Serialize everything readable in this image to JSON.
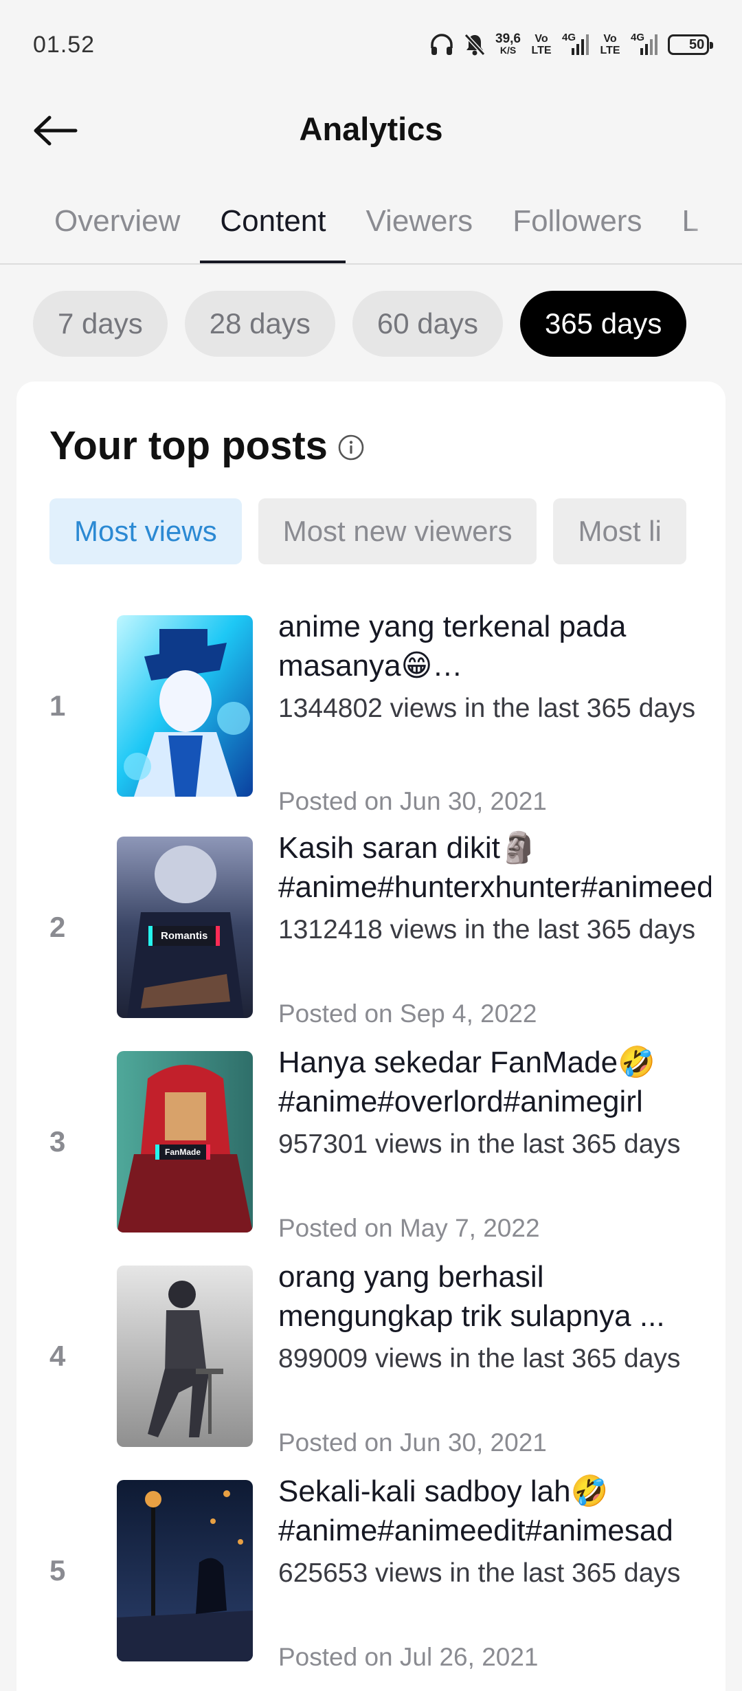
{
  "status_bar": {
    "time": "01.52",
    "net_speed_value": "39,6",
    "net_speed_unit": "K/S",
    "sim1_volte": "Vo\nLTE",
    "sim1_network": "4G",
    "sim2_volte": "Vo\nLTE",
    "sim2_network": "4G",
    "battery_level": "50",
    "battery_percent": 50
  },
  "header": {
    "title": "Analytics"
  },
  "tabs": [
    {
      "label": "Overview",
      "active": false
    },
    {
      "label": "Content",
      "active": true
    },
    {
      "label": "Viewers",
      "active": false
    },
    {
      "label": "Followers",
      "active": false
    },
    {
      "label": "L",
      "active": false
    }
  ],
  "periods": [
    {
      "label": "7 days",
      "active": false
    },
    {
      "label": "28 days",
      "active": false
    },
    {
      "label": "60 days",
      "active": false
    },
    {
      "label": "365 days",
      "active": true
    }
  ],
  "top_posts": {
    "title": "Your top posts",
    "sort_options": [
      {
        "label": "Most views",
        "active": true
      },
      {
        "label": "Most new viewers",
        "active": false
      },
      {
        "label": "Most li",
        "active": false
      }
    ],
    "posts": [
      {
        "rank": "1",
        "caption": "anime yang terkenal pada masanya😁#kaitokid#anime#animeedit",
        "views": "1344802 views in the last 365 days",
        "date": "Posted on Jun 30, 2021",
        "thumb_colors": [
          "#1ec8f5",
          "#0b3f9e",
          "#bff6ff"
        ]
      },
      {
        "rank": "2",
        "caption": "Kasih saran dikit🗿 #anime#hunterxhunter#animeedit",
        "views": "1312418 views in the last 365 days",
        "date": "Posted on Sep 4, 2022",
        "overlay_label": "Romantis",
        "thumb_colors": [
          "#3a4565",
          "#1d2236",
          "#8e97b8"
        ]
      },
      {
        "rank": "3",
        "caption": "Hanya sekedar FanMade🤣 #anime#overlord#animegirl",
        "views": "957301 views in the last 365 days",
        "date": "Posted on May 7, 2022",
        "overlay_label": "FanMade",
        "thumb_colors": [
          "#4fa89a",
          "#c2202b",
          "#7a1820"
        ]
      },
      {
        "rank": "4",
        "caption": "orang yang berhasil mengungkap trik sulapnya ...",
        "views": "899009 views in the last 365 days",
        "date": "Posted on Jun 30, 2021",
        "thumb_colors": [
          "#d8d8d8",
          "#9a9a9a",
          "#3c3c44"
        ]
      },
      {
        "rank": "5",
        "caption": "Sekali-kali sadboy lah🤣 #anime#animeedit#animesad",
        "views": "625653 views in the last 365 days",
        "date": "Posted on Jul 26, 2021",
        "thumb_colors": [
          "#0e1a33",
          "#2b3f6b",
          "#e8a043"
        ]
      }
    ]
  }
}
